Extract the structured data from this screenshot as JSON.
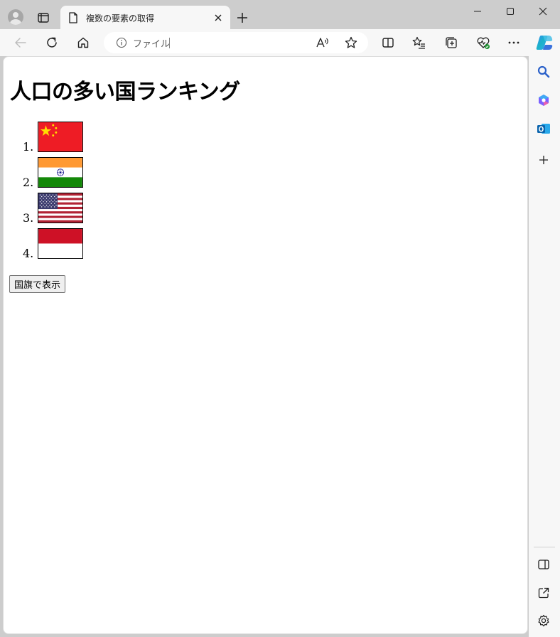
{
  "browser": {
    "tab": {
      "title": "複数の要素の取得"
    },
    "address": {
      "scheme_label": "ファイル"
    }
  },
  "page": {
    "heading": "人口の多い国ランキング",
    "ranking": [
      {
        "number": "1.",
        "flag": "china-flag"
      },
      {
        "number": "2.",
        "flag": "india-flag"
      },
      {
        "number": "3.",
        "flag": "usa-flag"
      },
      {
        "number": "4.",
        "flag": "indonesia-flag"
      }
    ],
    "button_label": "国旗で表示"
  },
  "colors": {
    "page_background": "#ffffff",
    "chrome": "#f7f7f7",
    "tab_strip": "#cdcdcd",
    "china_red": "#ee1c25",
    "india_saffron": "#ff9933",
    "india_green": "#138808",
    "usa_red": "#b22234",
    "usa_blue": "#3c3b6e",
    "indonesia_red": "#ce1126"
  }
}
